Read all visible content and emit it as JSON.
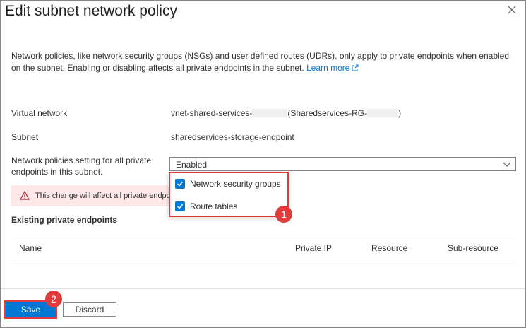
{
  "panel": {
    "title": "Edit subnet network policy",
    "close_icon": "close-icon"
  },
  "description": {
    "text": "Network policies, like network security groups (NSGs) and user defined routes (UDRs), only apply to private endpoints when enabled on the subnet. Enabling or disabling affects all private endpoints in the subnet.",
    "link": "Learn more",
    "link_icon": "external-link-icon"
  },
  "fields": {
    "vnet_label": "Virtual network",
    "vnet_value_prefix": "vnet-shared-services-",
    "vnet_value_rg_prefix": "(Sharedservices-RG-",
    "vnet_value_suffix": ")",
    "subnet_label": "Subnet",
    "subnet_value": "sharedservices-storage-endpoint",
    "policy_label": "Network policies setting for all private endpoints in this subnet.",
    "policy_value": "Enabled"
  },
  "dropdown_options": [
    {
      "label": "Network security groups",
      "checked": true
    },
    {
      "label": "Route tables",
      "checked": true
    }
  ],
  "warning": {
    "text": "This change will affect all private endpoi",
    "icon": "warning-icon"
  },
  "endpoints": {
    "section_title": "Existing private endpoints",
    "columns": [
      "Name",
      "Private IP",
      "Resource",
      "Sub-resource"
    ]
  },
  "footer": {
    "save_label": "Save",
    "discard_label": "Discard"
  },
  "callouts": [
    "1",
    "2"
  ],
  "colors": {
    "accent": "#0078d4",
    "highlight": "#e03c3c",
    "warning_bg": "#fde7e9"
  }
}
